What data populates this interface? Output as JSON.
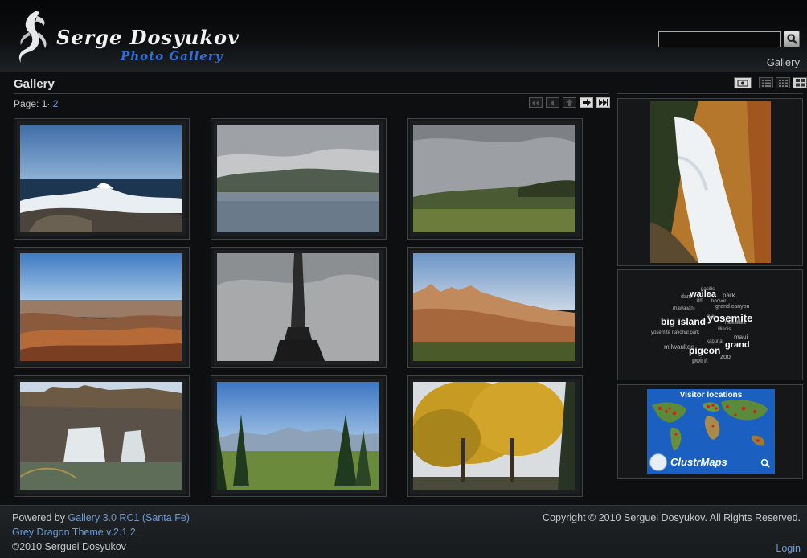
{
  "header": {
    "title": "Serge Dosyukov",
    "subtitle": "Photo Gallery",
    "search": {
      "value": "",
      "placeholder": ""
    },
    "breadcrumb": "Gallery"
  },
  "main": {
    "page_title": "Gallery",
    "pager": {
      "label": "Page:",
      "current": "1",
      "separator": "·",
      "next": "2"
    },
    "nav_icons": [
      "first-page-icon",
      "previous-page-icon",
      "parent-album-icon",
      "next-page-icon",
      "last-page-icon"
    ],
    "view_icons": [
      "slideshow-icon",
      "list-view-icon",
      "small-grid-icon",
      "large-grid-icon"
    ],
    "photos": [
      {
        "name": "ocean-waves-photo"
      },
      {
        "name": "bay-hills-photo"
      },
      {
        "name": "cloudy-field-photo"
      },
      {
        "name": "grand-canyon-photo"
      },
      {
        "name": "monument-photo"
      },
      {
        "name": "badlands-photo"
      },
      {
        "name": "shoshone-falls-photo"
      },
      {
        "name": "mountain-meadow-photo"
      },
      {
        "name": "autumn-trees-photo"
      }
    ]
  },
  "sidebar": {
    "featured_image": "waterfall-photo",
    "tags": [
      {
        "text": "wailea",
        "size": 11,
        "bold": true
      },
      {
        "text": "pacific",
        "size": 6
      },
      {
        "text": "dam",
        "size": 7
      },
      {
        "text": "park",
        "size": 8
      },
      {
        "text": "rim",
        "size": 6
      },
      {
        "text": "hoover",
        "size": 6
      },
      {
        "text": "(hawaiian)",
        "size": 6
      },
      {
        "text": "grand canyon",
        "size": 7
      },
      {
        "text": "big island",
        "size": 12,
        "bold": true
      },
      {
        "text": "yosemite",
        "size": 13,
        "bold": true
      },
      {
        "text": "hwy",
        "size": 6
      },
      {
        "text": "haleakala",
        "size": 6
      },
      {
        "text": "yosemite national park",
        "size": 6
      },
      {
        "text": "illinois",
        "size": 6
      },
      {
        "text": "maui",
        "size": 8
      },
      {
        "text": "milwaukee",
        "size": 8
      },
      {
        "text": "kapuna",
        "size": 6
      },
      {
        "text": "grand",
        "size": 11,
        "bold": true
      },
      {
        "text": "pigeon",
        "size": 12,
        "bold": true
      },
      {
        "text": "zoo",
        "size": 8
      },
      {
        "text": "point",
        "size": 9
      }
    ],
    "clustrmaps": {
      "title": "Visitor locations",
      "brand": "ClustrMaps"
    }
  },
  "footer": {
    "powered_by_label": "Powered by",
    "gallery_link": "Gallery 3.0 RC1 (Santa Fe)",
    "theme_link": "Grey Dragon Theme v.2.1.2",
    "copyright_short": "©2010 Serguei Dosyukov",
    "copyright_full": "Copyright © 2010 Serguei Dosyukov. All Rights Reserved.",
    "login": "Login"
  }
}
